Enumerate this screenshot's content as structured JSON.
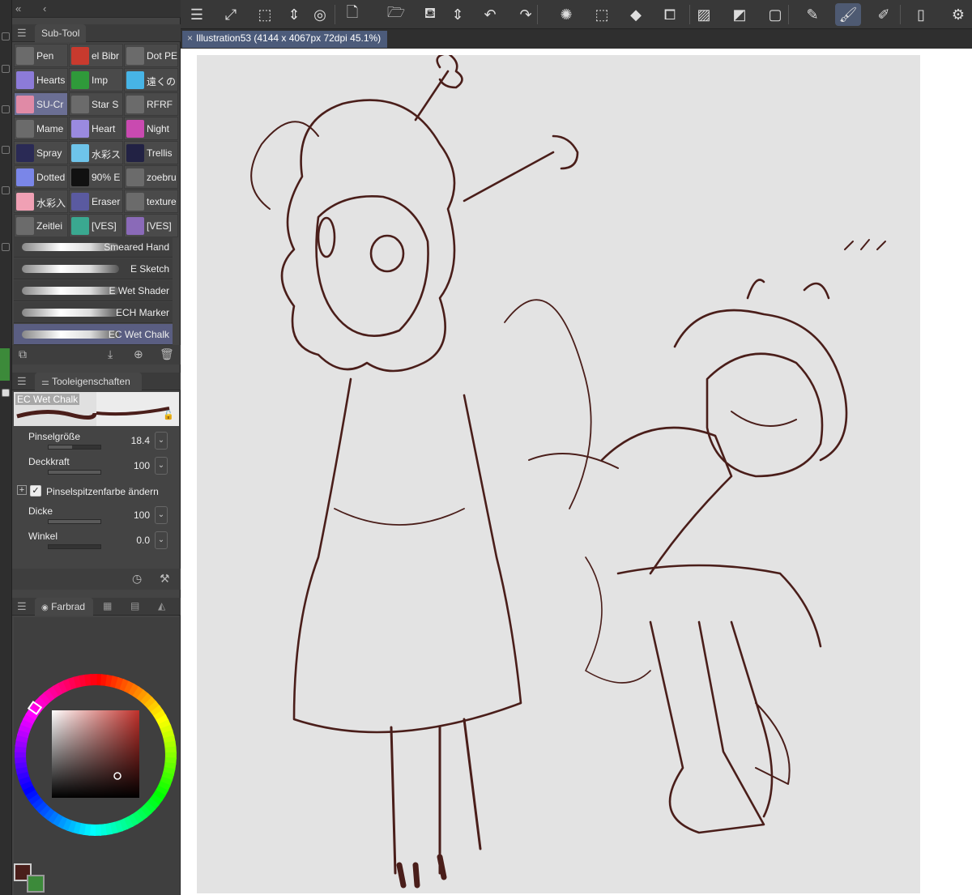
{
  "toolbar_icons": [
    "menu-icon",
    "resize-canvas-icon",
    "transform-icon",
    "updown-icon",
    "spiral-icon",
    "new-file-icon",
    "open-folder-icon",
    "save-icon",
    "updown-icon",
    "undo-icon",
    "redo-icon",
    "loading-icon",
    "selection-icon",
    "fill-icon",
    "crop-icon",
    "hide-selection-icon",
    "invert-icon",
    "frame-icon",
    "pen-tool-icon",
    "brush-tool-icon",
    "eraser-tool-icon",
    "device-icon",
    "settings-icon"
  ],
  "document": {
    "tab_title": "Illustration53 (4144 x 4067px 72dpi 45.1%)"
  },
  "subtool_panel": {
    "header_label": "Sub-Tool",
    "grid": [
      {
        "label": "Pen",
        "color": "#6b6b6b"
      },
      {
        "label": "el Bibr",
        "color": "#c83a2e"
      },
      {
        "label": "Dot PE",
        "color": "#6b6b6b"
      },
      {
        "label": "Hearts",
        "color": "#8c7bd8"
      },
      {
        "label": "Imp",
        "color": "#2f9a3a"
      },
      {
        "label": "遠くの",
        "color": "#47b4e6"
      },
      {
        "label": "SU-Cr",
        "color": "#e08aa6"
      },
      {
        "label": "Star S",
        "color": "#6b6b6b"
      },
      {
        "label": "RFRF",
        "color": "#6b6b6b"
      },
      {
        "label": "Mame",
        "color": "#6b6b6b"
      },
      {
        "label": "Heart",
        "color": "#9a8ae0"
      },
      {
        "label": "Night",
        "color": "#c94ab0"
      },
      {
        "label": "Spray",
        "color": "#2a2a55"
      },
      {
        "label": "水彩ス",
        "color": "#6ec4ea"
      },
      {
        "label": "Trellis",
        "color": "#222244"
      },
      {
        "label": "Dotted",
        "color": "#7a86e8"
      },
      {
        "label": "90% E",
        "color": "#111111"
      },
      {
        "label": "zoebru",
        "color": "#6b6b6b"
      },
      {
        "label": "水彩入",
        "color": "#f0a0b4"
      },
      {
        "label": "Eraser",
        "color": "#5a5aa0"
      },
      {
        "label": "texture",
        "color": "#6b6b6b"
      },
      {
        "label": "Zeitlei",
        "color": "#6b6b6b"
      },
      {
        "label": "[VES]",
        "color": "#3aa890"
      },
      {
        "label": "[VES]",
        "color": "#8a6ab8"
      }
    ],
    "brushes": [
      "Smeared Hand",
      "E Sketch",
      "E Wet Shader",
      "ECH Marker",
      "EC Wet Chalk"
    ],
    "selected_brush": "EC Wet Chalk"
  },
  "tool_properties": {
    "header_label": "Tooleigenschaften",
    "preview_label": "EC Wet Chalk",
    "props": [
      {
        "label": "Pinselgröße",
        "value": "18.4",
        "level": 0.45
      },
      {
        "label": "Deckkraft",
        "value": "100",
        "level": 1.0
      }
    ],
    "checkbox_label": "Pinselspitzenfarbe ändern",
    "props2": [
      {
        "label": "Dicke",
        "value": "100",
        "level": 1.0
      },
      {
        "label": "Winkel",
        "value": "0.0",
        "level": 0.0
      }
    ]
  },
  "color_panel": {
    "header_label": "Farbrad",
    "main_color": "#4a1e1a",
    "sub_color": "#3c8a3a"
  },
  "accent": "#4c5b7a"
}
